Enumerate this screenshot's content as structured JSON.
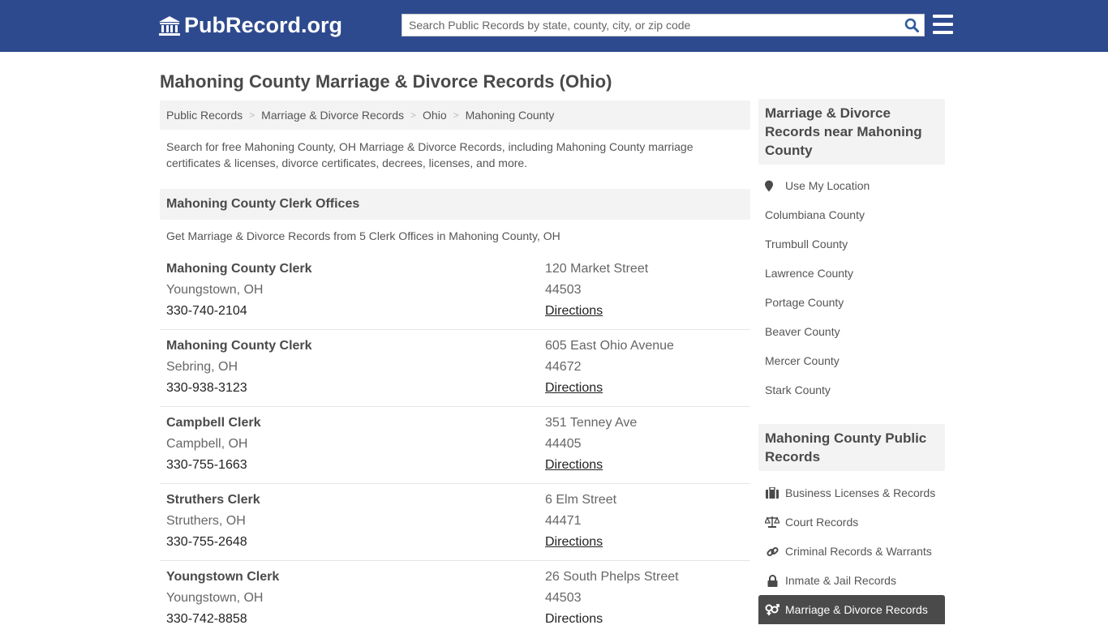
{
  "header": {
    "logo_text": "PubRecord.org",
    "search_placeholder": "Search Public Records by state, county, city, or zip code"
  },
  "page_title": "Mahoning County Marriage & Divorce Records (Ohio)",
  "breadcrumb": [
    "Public Records",
    "Marriage & Divorce Records",
    "Ohio",
    "Mahoning County"
  ],
  "intro": "Search for free Mahoning County, OH Marriage & Divorce Records, including Mahoning County marriage certificates & licenses, divorce certificates, decrees, licenses, and more.",
  "clerk_section": {
    "heading": "Mahoning County Clerk Offices",
    "subtext": "Get Marriage & Divorce Records from 5 Clerk Offices in Mahoning County, OH",
    "offices": [
      {
        "name": "Mahoning County Clerk",
        "city": "Youngstown, OH",
        "phone": "330-740-2104",
        "address": "120 Market Street",
        "zip": "44503",
        "link": "Directions"
      },
      {
        "name": "Mahoning County Clerk",
        "city": "Sebring, OH",
        "phone": "330-938-3123",
        "address": "605 East Ohio Avenue",
        "zip": "44672",
        "link": "Directions"
      },
      {
        "name": "Campbell Clerk",
        "city": "Campbell, OH",
        "phone": "330-755-1663",
        "address": "351 Tenney Ave",
        "zip": "44405",
        "link": "Directions"
      },
      {
        "name": "Struthers Clerk",
        "city": "Struthers, OH",
        "phone": "330-755-2648",
        "address": "6 Elm Street",
        "zip": "44471",
        "link": "Directions"
      },
      {
        "name": "Youngstown Clerk",
        "city": "Youngstown, OH",
        "phone": "330-742-8858",
        "address": "26 South Phelps Street",
        "zip": "44503",
        "link": "Directions"
      }
    ]
  },
  "sidebar": {
    "nearby_heading": "Marriage & Divorce Records near Mahoning County",
    "use_location": "Use My Location",
    "nearby": [
      "Columbiana County",
      "Trumbull County",
      "Lawrence County",
      "Portage County",
      "Beaver County",
      "Mercer County",
      "Stark County"
    ],
    "public_heading": "Mahoning County Public Records",
    "public_records": [
      {
        "label": "Business Licenses & Records",
        "icon": "briefcase-icon"
      },
      {
        "label": "Court Records",
        "icon": "scale-icon"
      },
      {
        "label": "Criminal Records & Warrants",
        "icon": "link-icon"
      },
      {
        "label": "Inmate & Jail Records",
        "icon": "lock-icon"
      },
      {
        "label": "Marriage & Divorce Records",
        "icon": "gender-icon",
        "active": true
      }
    ]
  }
}
